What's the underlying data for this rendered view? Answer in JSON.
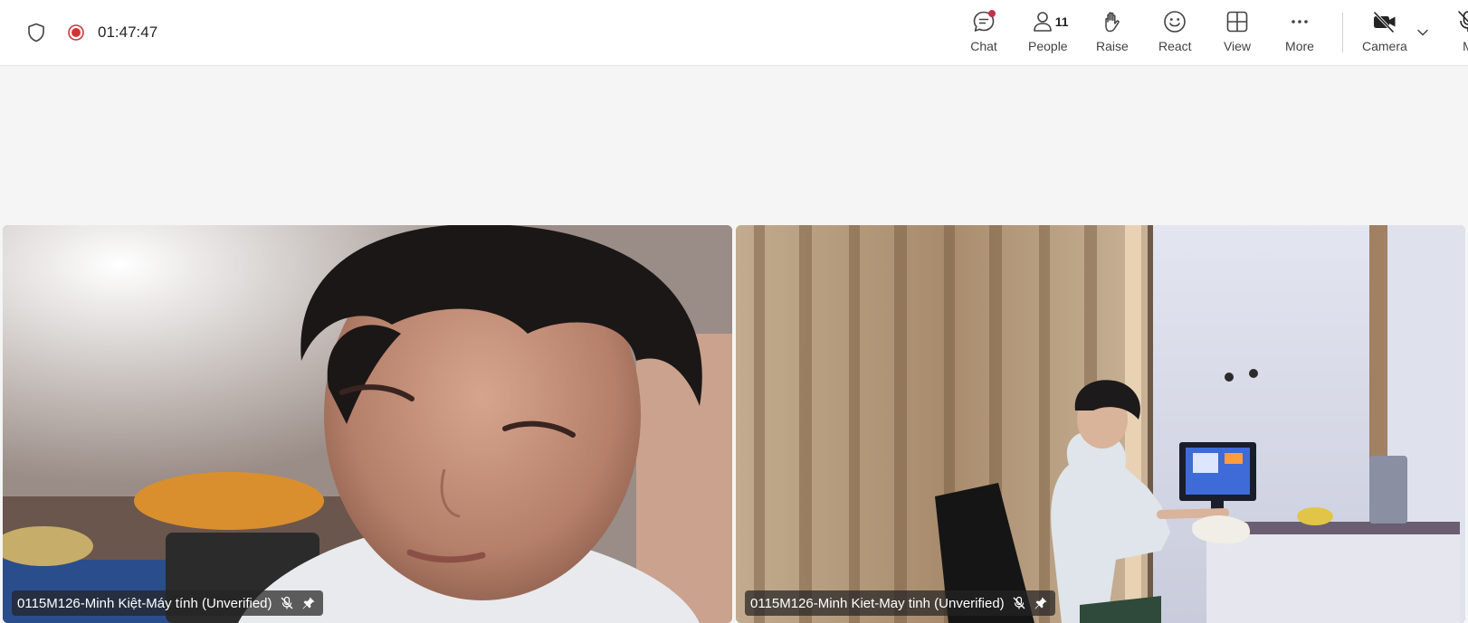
{
  "meeting": {
    "timer": "01:47:47"
  },
  "toolbar": {
    "chat_label": "Chat",
    "people_label": "People",
    "people_count": "11",
    "raise_label": "Raise",
    "react_label": "React",
    "view_label": "View",
    "more_label": "More",
    "camera_label": "Camera",
    "mic_label": "M"
  },
  "participants": [
    {
      "name": "0115M126-Minh Kiệt-Máy tính (Unverified)"
    },
    {
      "name": "0115M126-Minh Kiet-May tinh (Unverified)"
    }
  ],
  "colors": {
    "recording": "#d13438",
    "notification": "#c4314b",
    "toolbar_bg": "#ffffff",
    "stage_bg": "#f5f5f5"
  },
  "icons": [
    "shield-icon",
    "recording-icon",
    "chat-icon",
    "people-icon",
    "raise-hand-icon",
    "react-icon",
    "view-icon",
    "more-icon",
    "camera-off-icon",
    "chevron-down-icon",
    "mic-off-icon",
    "mic-muted-icon",
    "pin-icon"
  ]
}
